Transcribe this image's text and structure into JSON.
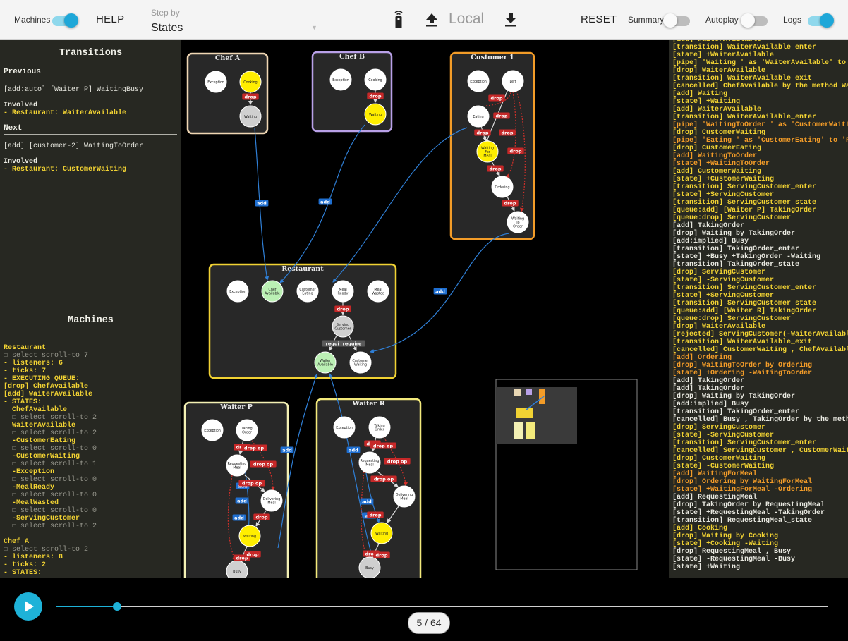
{
  "toolbar": {
    "machines_label": "Machines",
    "machines_on": true,
    "help_label": "HELP",
    "step_by_label": "Step by",
    "step_by_value": "States",
    "local_label": "Local",
    "reset_label": "RESET",
    "summary_label": "Summary",
    "summary_on": false,
    "autoplay_label": "Autoplay",
    "autoplay_on": false,
    "logs_label": "Logs",
    "logs_on": true
  },
  "transitions": {
    "title": "Transitions",
    "previous_heading": "Previous",
    "previous_line": "[add:auto] [Waiter P] WaitingBusy",
    "previous_involved_label": "Involved",
    "previous_involved_item": "- Restaurant: WaiterAvailable",
    "next_heading": "Next",
    "next_line": "[add] [customer-2] WaitingToOrder",
    "next_involved_label": "Involved",
    "next_involved_item": "- Restaurant: CustomerWaiting"
  },
  "machines": {
    "title": "Machines",
    "lines": [
      {
        "t": "Restaurant",
        "c": "yellow bold"
      },
      {
        "t": "☐ select scroll-to 7",
        "c": "dim"
      },
      {
        "t": "- listeners: 6",
        "c": "yellow bold"
      },
      {
        "t": "- ticks: 7",
        "c": "yellow bold"
      },
      {
        "t": "- EXECUTING QUEUE:",
        "c": "yellow bold"
      },
      {
        "t": "[drop] ChefAvailable",
        "c": "yellow bold"
      },
      {
        "t": "[add] WaiterAvailable",
        "c": "yellow bold"
      },
      {
        "t": "- STATES:",
        "c": "yellow bold"
      },
      {
        "t": "  ChefAvailable",
        "c": "yellow bold"
      },
      {
        "t": "  ☐ select scroll-to 2",
        "c": "dim"
      },
      {
        "t": "  WaiterAvailable",
        "c": "yellow bold"
      },
      {
        "t": "  ☐ select scroll-to 2",
        "c": "dim"
      },
      {
        "t": "  -CustomerEating",
        "c": "yellow bold"
      },
      {
        "t": "  ☐ select scroll-to 0",
        "c": "dim"
      },
      {
        "t": "  -CustomerWaiting",
        "c": "yellow bold"
      },
      {
        "t": "  ☐ select scroll-to 1",
        "c": "dim"
      },
      {
        "t": "  -Exception",
        "c": "yellow bold"
      },
      {
        "t": "  ☐ select scroll-to 0",
        "c": "dim"
      },
      {
        "t": "  -MealReady",
        "c": "yellow bold"
      },
      {
        "t": "  ☐ select scroll-to 0",
        "c": "dim"
      },
      {
        "t": "  -MealWasted",
        "c": "yellow bold"
      },
      {
        "t": "  ☐ select scroll-to 0",
        "c": "dim"
      },
      {
        "t": "  -ServingCustomer",
        "c": "yellow bold"
      },
      {
        "t": "  ☐ select scroll-to 2",
        "c": "dim"
      },
      {
        "t": "",
        "c": "dim"
      },
      {
        "t": "Chef A",
        "c": "yellow bold"
      },
      {
        "t": "☐ select scroll-to 2",
        "c": "dim"
      },
      {
        "t": "- listeners: 8",
        "c": "yellow bold"
      },
      {
        "t": "- ticks: 2",
        "c": "yellow bold"
      },
      {
        "t": "- STATES:",
        "c": "yellow bold"
      }
    ]
  },
  "graph": {
    "machines": [
      {
        "name": "Chef A",
        "color": "#f0d7b4"
      },
      {
        "name": "Chef B",
        "color": "#b9a1e8"
      },
      {
        "name": "Customer 1",
        "color": "#f39c28"
      },
      {
        "name": "Restaurant",
        "color": "#f1d233"
      },
      {
        "name": "Waiter P",
        "color": "#f3f0b4"
      },
      {
        "name": "Waiter R",
        "color": "#f3ea7c"
      }
    ],
    "states": {
      "chef_a": [
        "Exception",
        "Cooking",
        "Waiting"
      ],
      "chef_b": [
        "Exception",
        "Cooking",
        "Waiting"
      ],
      "customer": [
        "Exception",
        "Left",
        "Eating",
        "Waiting For Meal",
        "Ordering",
        "Waiting To Order"
      ],
      "restaurant": [
        "Exception",
        "Chef Available",
        "Customer Eating",
        "Meal Ready",
        "Meal Wasted",
        "Serving Customer",
        "Waiter Available",
        "Customer Waiting"
      ],
      "waiter_p": [
        "Exception",
        "Taking Order",
        "Requesting Meal",
        "Delivering Meal",
        "Waiting",
        "Busy"
      ],
      "waiter_r": [
        "Exception",
        "Taking Order",
        "Requesting Meal",
        "Delivering Meal",
        "Waiting",
        "Busy"
      ]
    },
    "edge_labels": {
      "add": "add",
      "drop": "drop",
      "require": "require",
      "drop_op": "drop op"
    }
  },
  "log": [
    {
      "t": "[add] WaiterAvailable",
      "c": "c-y"
    },
    {
      "t": "[transition] WaiterAvailable_enter",
      "c": "c-y"
    },
    {
      "t": "[state] +WaiterAvailable",
      "c": "c-y"
    },
    {
      "t": "[pipe] 'Waiting ' as 'WaiterAvailable' to",
      "c": "c-y"
    },
    {
      "t": "[drop] WaiterAvailable",
      "c": "c-y"
    },
    {
      "t": "[transition] WaiterAvailable_exit",
      "c": "c-y"
    },
    {
      "t": "[cancelled] ChefAvailable by the method Wa",
      "c": "c-y"
    },
    {
      "t": "[add] Waiting",
      "c": "c-y"
    },
    {
      "t": "[state] +Waiting",
      "c": "c-y"
    },
    {
      "t": "[add] WaiterAvailable",
      "c": "c-y"
    },
    {
      "t": "[transition] WaiterAvailable_enter",
      "c": "c-y"
    },
    {
      "t": "[pipe] 'WaitingToOrder ' as 'CustomerWaiti",
      "c": "c-o"
    },
    {
      "t": "[drop] CustomerWaiting",
      "c": "c-y"
    },
    {
      "t": "[pipe] 'Eating ' as 'CustomerEating' to 'R",
      "c": "c-o"
    },
    {
      "t": "[drop] CustomerEating",
      "c": "c-y"
    },
    {
      "t": "[add] WaitingToOrder",
      "c": "c-o"
    },
    {
      "t": "[state] +WaitingToOrder",
      "c": "c-o"
    },
    {
      "t": "[add] CustomerWaiting",
      "c": "c-y"
    },
    {
      "t": "[state] +CustomerWaiting",
      "c": "c-y"
    },
    {
      "t": "[transition] ServingCustomer_enter",
      "c": "c-y"
    },
    {
      "t": "[state] +ServingCustomer",
      "c": "c-y"
    },
    {
      "t": "[transition] ServingCustomer_state",
      "c": "c-y"
    },
    {
      "t": "[queue:add] [Waiter P] TakingOrder",
      "c": "c-y"
    },
    {
      "t": "[queue:drop] ServingCustomer",
      "c": "c-y"
    },
    {
      "t": "[add] TakingOrder",
      "c": "c-norm"
    },
    {
      "t": "[drop] Waiting by TakingOrder",
      "c": "c-norm"
    },
    {
      "t": "[add:implied] Busy",
      "c": "c-norm"
    },
    {
      "t": "[transition] TakingOrder_enter",
      "c": "c-norm"
    },
    {
      "t": "[state] +Busy +TakingOrder -Waiting",
      "c": "c-norm"
    },
    {
      "t": "[transition] TakingOrder_state",
      "c": "c-norm"
    },
    {
      "t": "[drop] ServingCustomer",
      "c": "c-y"
    },
    {
      "t": "[state] -ServingCustomer",
      "c": "c-y"
    },
    {
      "t": "[transition] ServingCustomer_enter",
      "c": "c-y"
    },
    {
      "t": "[state] +ServingCustomer",
      "c": "c-y"
    },
    {
      "t": "[transition] ServingCustomer_state",
      "c": "c-y"
    },
    {
      "t": "[queue:add] [Waiter R] TakingOrder",
      "c": "c-y"
    },
    {
      "t": "[queue:drop] ServingCustomer",
      "c": "c-y"
    },
    {
      "t": "[drop] WaiterAvailable",
      "c": "c-y"
    },
    {
      "t": "[rejected] ServingCustomer(-WaiterAvailabl",
      "c": "c-y"
    },
    {
      "t": "[transition] WaiterAvailable_exit",
      "c": "c-y"
    },
    {
      "t": "[cancelled] CustomerWaiting , ChefAvailabl",
      "c": "c-y"
    },
    {
      "t": "[add] Ordering",
      "c": "c-o"
    },
    {
      "t": "[drop] WaitingToOrder by Ordering",
      "c": "c-o"
    },
    {
      "t": "[state] +Ordering -WaitingToOrder",
      "c": "c-o"
    },
    {
      "t": "[add] TakingOrder",
      "c": "c-norm"
    },
    {
      "t": "[add] TakingOrder",
      "c": "c-norm"
    },
    {
      "t": "[drop] Waiting by TakingOrder",
      "c": "c-norm"
    },
    {
      "t": "[add:implied] Busy",
      "c": "c-norm"
    },
    {
      "t": "[transition] TakingOrder_enter",
      "c": "c-norm"
    },
    {
      "t": "[cancelled] Busy , TakingOrder by the meth",
      "c": "c-norm"
    },
    {
      "t": "[drop] ServingCustomer",
      "c": "c-y"
    },
    {
      "t": "[state] -ServingCustomer",
      "c": "c-y"
    },
    {
      "t": "[transition] ServingCustomer_enter",
      "c": "c-y"
    },
    {
      "t": "[cancelled] ServingCustomer , CustomerWait",
      "c": "c-y"
    },
    {
      "t": "[drop] CustomerWaiting",
      "c": "c-y"
    },
    {
      "t": "[state] -CustomerWaiting",
      "c": "c-y"
    },
    {
      "t": "[add] WaitingForMeal",
      "c": "c-o"
    },
    {
      "t": "[drop] Ordering by WaitingForMeal",
      "c": "c-o"
    },
    {
      "t": "[state] +WaitingForMeal -Ordering",
      "c": "c-o"
    },
    {
      "t": "[add] RequestingMeal",
      "c": "c-norm"
    },
    {
      "t": "[drop] TakingOrder by RequestingMeal",
      "c": "c-norm"
    },
    {
      "t": "[state] +RequestingMeal -TakingOrder",
      "c": "c-norm"
    },
    {
      "t": "[transition] RequestingMeal_state",
      "c": "c-norm"
    },
    {
      "t": "[add] Cooking",
      "c": "c-y"
    },
    {
      "t": "[drop] Waiting by Cooking",
      "c": "c-y"
    },
    {
      "t": "[state] +Cooking -Waiting",
      "c": "c-y"
    },
    {
      "t": "[drop] RequestingMeal , Busy",
      "c": "c-norm"
    },
    {
      "t": "[state] -RequestingMeal -Busy",
      "c": "c-norm"
    },
    {
      "t": "[state] +Waiting",
      "c": "c-norm"
    }
  ],
  "player": {
    "step_counter": "5 / 64",
    "progress": 0.0786
  },
  "colors": {
    "accent": "#1ea7d8",
    "panel_bg": "#272822",
    "log_yellow": "#f1d233",
    "log_orange": "#f39c28",
    "state_active": "#ffee00",
    "state_pending": "#bbf0b4"
  }
}
